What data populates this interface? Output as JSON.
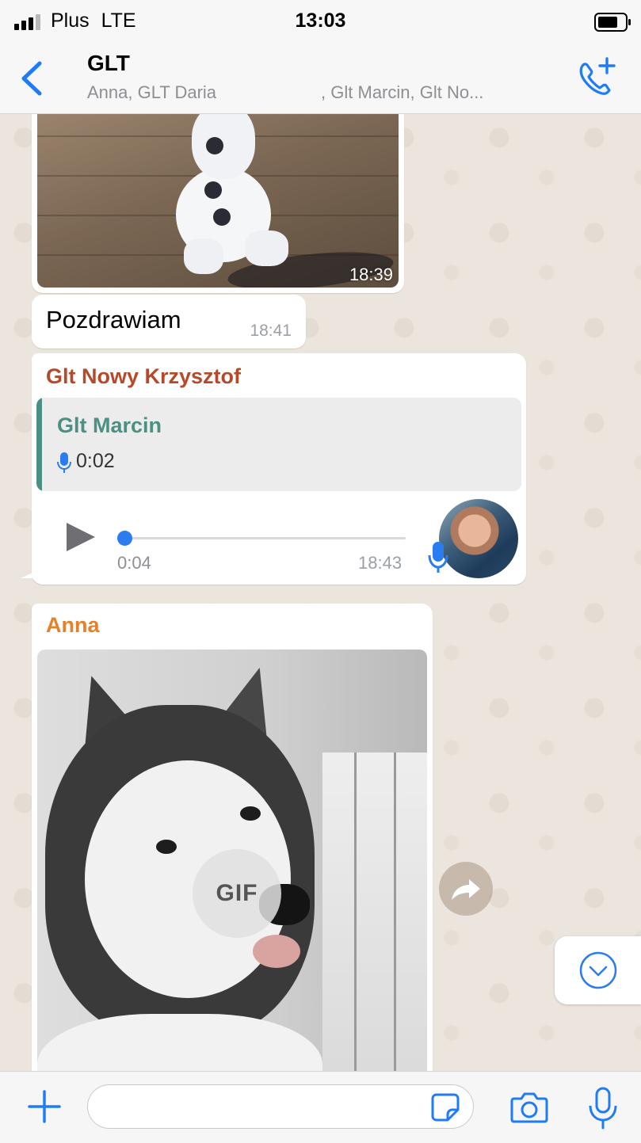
{
  "status_bar": {
    "carrier": "Plus",
    "network": "LTE",
    "time": "13:03"
  },
  "header": {
    "title": "GLT",
    "members_part1": "Anna, GLT Daria",
    "members_part2": ", Glt Marcin, Glt No...",
    "back_icon": "chevron-left-icon",
    "call_icon": "add-call-icon"
  },
  "messages": [
    {
      "type": "video",
      "time": "18:39"
    },
    {
      "type": "text",
      "body": "Pozdrawiam",
      "time": "18:41"
    },
    {
      "type": "voice",
      "sender": "Glt Nowy Krzysztof",
      "quoted_sender": "Glt Marcin",
      "quoted_duration": "0:02",
      "elapsed": "0:04",
      "time": "18:43",
      "progress": 0.02
    },
    {
      "type": "gif",
      "sender": "Anna",
      "badge": "GIF"
    }
  ],
  "composer": {
    "placeholder": ""
  },
  "colors": {
    "accent": "#2b7cf0",
    "sender_krzysztof": "#b54a2b",
    "sender_marcin": "#4c8f83",
    "sender_anna": "#e5812b",
    "chat_background": "#ece5dd"
  }
}
